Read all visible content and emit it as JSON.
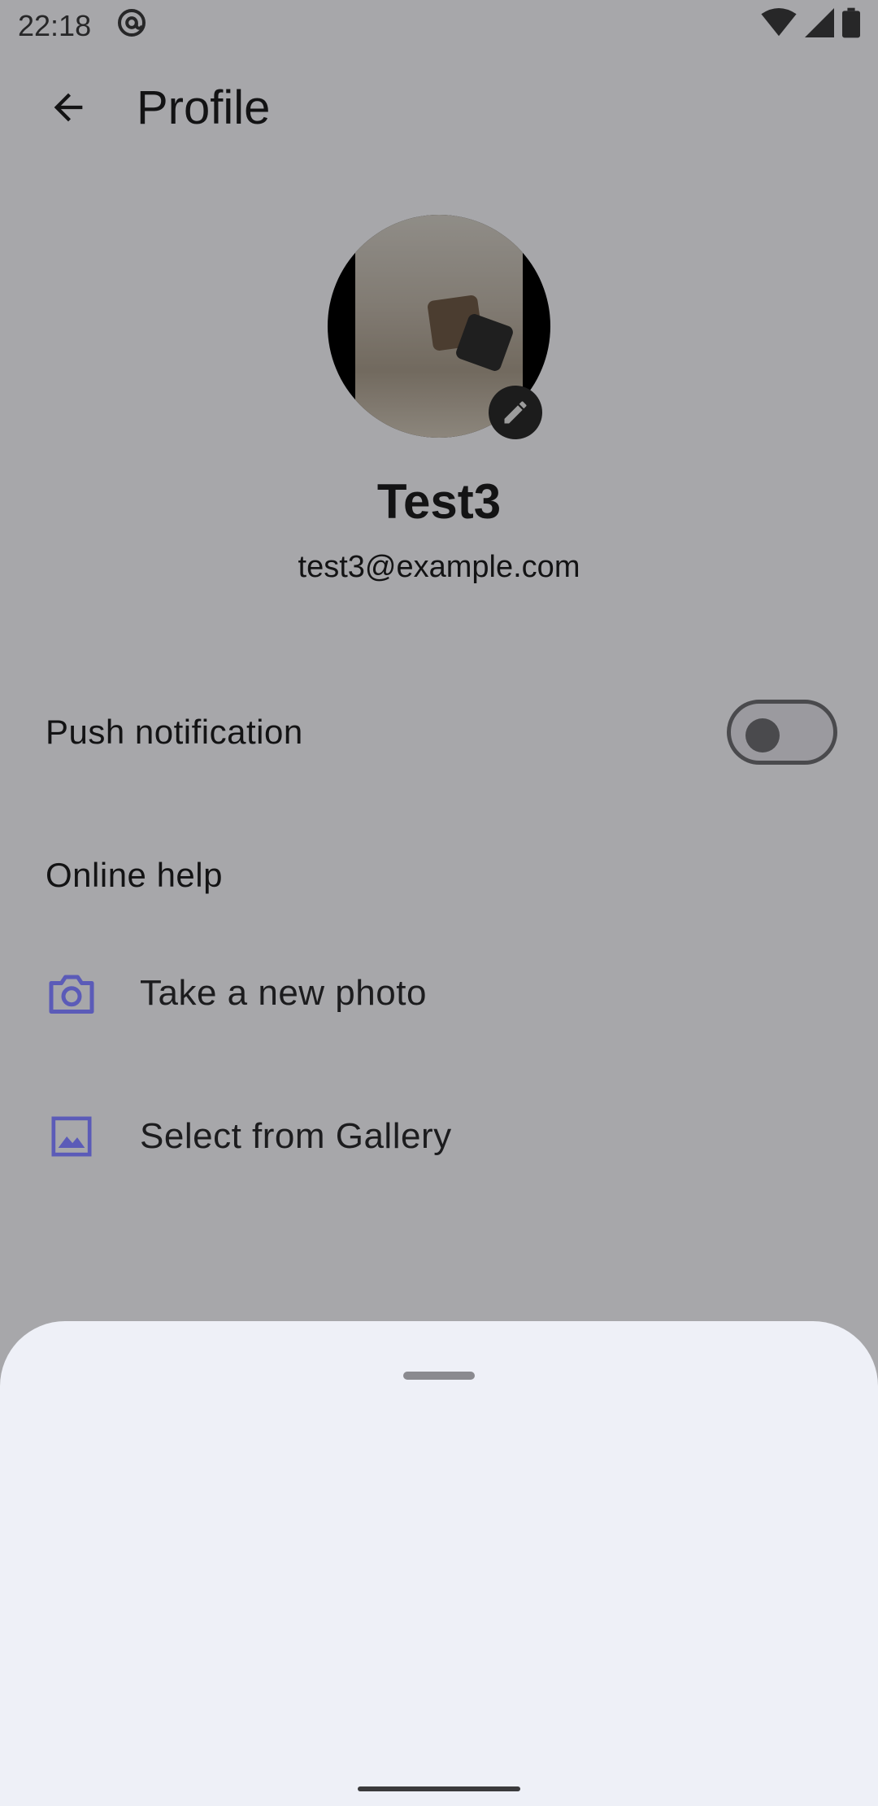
{
  "status_bar": {
    "time": "22:18",
    "icons": [
      "at-sign-icon",
      "wifi-icon",
      "cell-signal-icon",
      "battery-icon"
    ]
  },
  "app_bar": {
    "title": "Profile",
    "back_icon": "arrow-back-icon"
  },
  "profile": {
    "name": "Test3",
    "email": "test3@example.com",
    "edit_icon": "pencil-icon"
  },
  "settings": {
    "push_notification": {
      "label": "Push notification",
      "enabled": false
    },
    "online_help": {
      "label": "Online help"
    }
  },
  "bottom_sheet": {
    "options": [
      {
        "label": "Take a new photo",
        "icon": "camera-icon"
      },
      {
        "label": "Select from Gallery",
        "icon": "image-icon"
      }
    ]
  },
  "colors": {
    "accent": "#5b5bb8",
    "sheet_background": "#eef0f7",
    "scrim": "rgba(0,0,0,0.32)"
  }
}
